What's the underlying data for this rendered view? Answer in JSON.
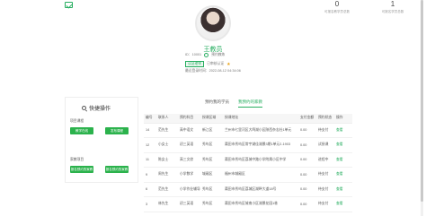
{
  "stats": [
    {
      "num": "0",
      "label": "可报名教学员总数"
    },
    {
      "num": "1",
      "label": "可报名学员总数"
    }
  ],
  "profile": {
    "name": "王教员",
    "id_text": "ID：10001",
    "status": "预约教练",
    "cert_tag": "认证老师",
    "cert_status": "已审核认证",
    "last_login": "最近登录时间：2022-08-12 04:34:06"
  },
  "quick": {
    "title": "快捷操作",
    "section1": "项目课程",
    "section1_buttons": [
      "教学在线",
      "发布课程"
    ],
    "section2": "家教项目",
    "section2_buttons": [
      "报名预约的家教",
      "报名预约的家教"
    ]
  },
  "tabs": [
    {
      "label": "预约我的学员",
      "active": false
    },
    {
      "label": "我预约的家教",
      "active": true
    }
  ],
  "table": {
    "headers": [
      "编号",
      "联系人",
      "预约科目",
      "授课区域",
      "授课地址",
      "支付金额",
      "预约状态",
      "操作"
    ],
    "rows": [
      [
        "14",
        "范先生",
        "高中语文",
        "新江区",
        "兰州市七里河区大鸣湖小区陕西杂志社1单元",
        "0.00",
        "待支付",
        "查看"
      ],
      [
        "12",
        "小女士",
        "初三英语",
        "秀屿区",
        "莆田市秀屿区常宇湖佳湖景3期1单元2-1903",
        "0.00",
        "试授课",
        "查看"
      ],
      [
        "11",
        "陈女士",
        "高三文综",
        "秀屿区",
        "莆田市秀屿区荔城中路小学附属小区中学",
        "0.00",
        "进程中",
        "查看"
      ],
      [
        "9",
        "周先生",
        "小学数学",
        "城厢区",
        "福州市城厢区",
        "0.00",
        "待支付",
        "查看"
      ],
      [
        "6",
        "范先生",
        "小学作业辅导",
        "秀屿区",
        "莆田市秀屿区荔城区湖畔大道18号",
        "0.00",
        "待支付",
        "查看"
      ],
      [
        "3",
        "林先生",
        "初三英语",
        "秀屿区",
        "莆田市秀屿区城南小区湖景花园1栋",
        "0.00",
        "待支付",
        "查看"
      ]
    ]
  }
}
